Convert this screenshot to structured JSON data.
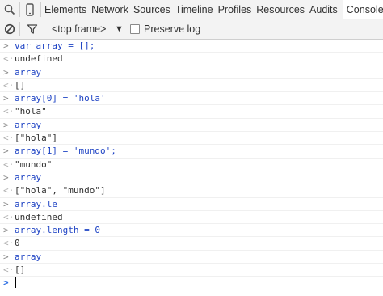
{
  "tabs": {
    "search_icon": "search-icon",
    "device_icon": "device-mode-icon",
    "items": [
      {
        "label": "Elements"
      },
      {
        "label": "Network"
      },
      {
        "label": "Sources"
      },
      {
        "label": "Timeline"
      },
      {
        "label": "Profiles"
      },
      {
        "label": "Resources"
      },
      {
        "label": "Audits"
      },
      {
        "label": "Console",
        "active": true
      }
    ]
  },
  "toolbar": {
    "clear_icon": "clear-console-icon",
    "filter_icon": "filter-icon",
    "frame_label": "<top frame>",
    "preserve_label": "Preserve log"
  },
  "console": {
    "lines": [
      {
        "kind": "input",
        "text": "var array = [];"
      },
      {
        "kind": "output",
        "text": "undefined",
        "style": "undefined"
      },
      {
        "kind": "input",
        "text": "array"
      },
      {
        "kind": "output",
        "text": "[]",
        "style": "plain"
      },
      {
        "kind": "input",
        "text": "array[0] = 'hola'"
      },
      {
        "kind": "output",
        "text": "\"hola\"",
        "style": "string"
      },
      {
        "kind": "input",
        "text": "array"
      },
      {
        "kind": "output",
        "text": "[\"hola\"]",
        "style": "plain"
      },
      {
        "kind": "input",
        "text": "array[1] = 'mundo';"
      },
      {
        "kind": "output",
        "text": "\"mundo\"",
        "style": "string"
      },
      {
        "kind": "input",
        "text": "array"
      },
      {
        "kind": "output",
        "text": "[\"hola\", \"mundo\"]",
        "style": "plain"
      },
      {
        "kind": "input",
        "text": "array.le"
      },
      {
        "kind": "output",
        "text": "undefined",
        "style": "undefined"
      },
      {
        "kind": "input",
        "text": "array.length = 0"
      },
      {
        "kind": "output",
        "text": "0",
        "style": "number"
      },
      {
        "kind": "input",
        "text": "array"
      },
      {
        "kind": "output",
        "text": "[]",
        "style": "plain"
      }
    ],
    "input_prompt": ">",
    "output_prompt": "<·",
    "colors": {
      "input_text": "#1e43c4",
      "string": "#c41a16",
      "number": "#1a1aa6",
      "undefined": "#808080",
      "plain": "#303030"
    }
  }
}
